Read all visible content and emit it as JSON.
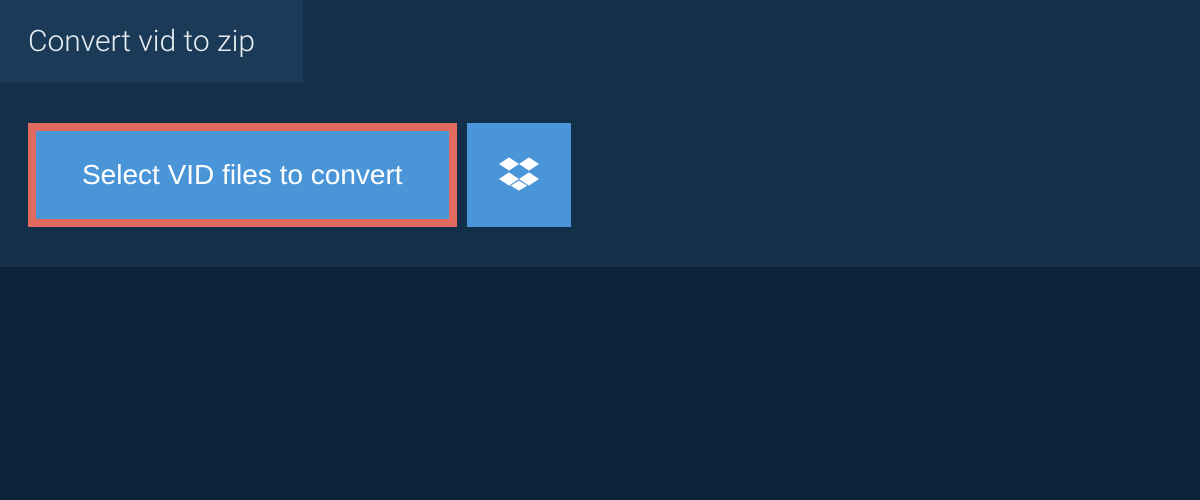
{
  "tab": {
    "title": "Convert vid to zip"
  },
  "actions": {
    "select_label": "Select VID files to convert"
  },
  "colors": {
    "highlight_border": "#e16a5f",
    "button_bg": "#4a95d8",
    "panel_bg": "#142f49",
    "tab_bg": "#1b3a57",
    "page_bg": "#0b2239"
  }
}
